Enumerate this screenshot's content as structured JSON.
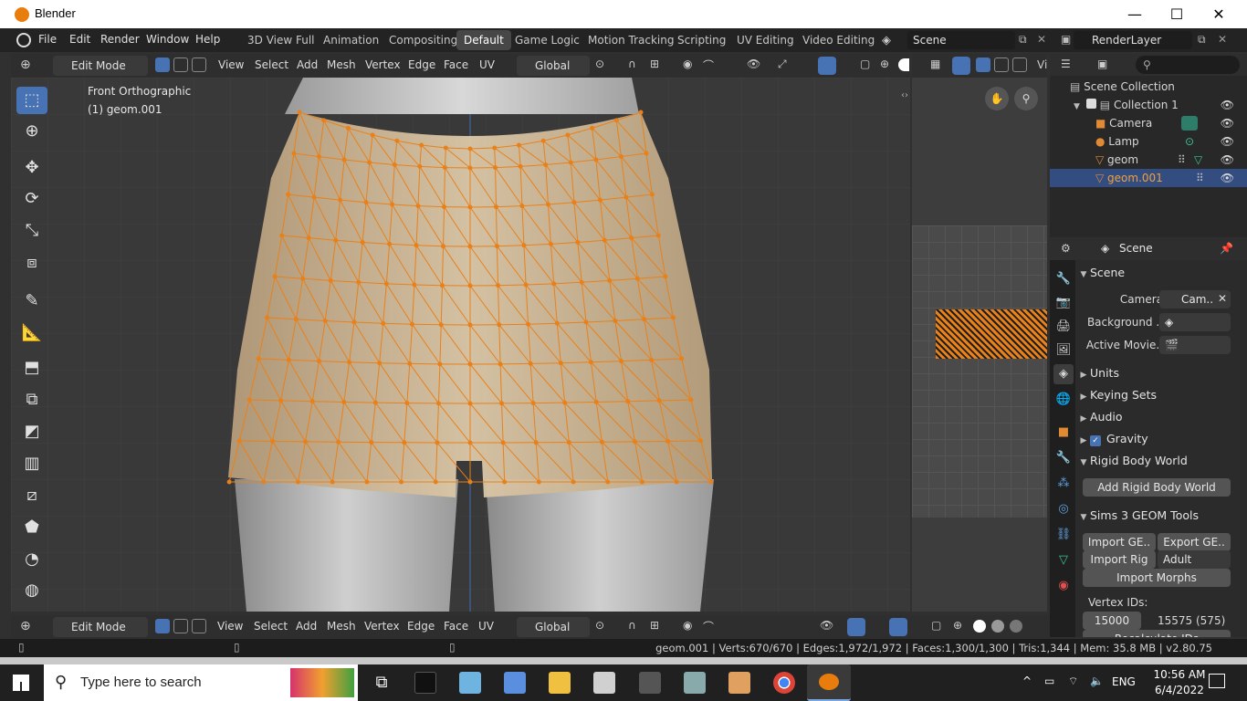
{
  "window": {
    "title": "Blender",
    "minimize": "—",
    "maximize": "☐",
    "close": "✕"
  },
  "menu": [
    "File",
    "Edit",
    "Render",
    "Window",
    "Help"
  ],
  "workspaces": [
    "3D View Full",
    "Animation",
    "Compositing",
    "Default",
    "Game Logic",
    "Motion Tracking",
    "Scripting",
    "UV Editing",
    "Video Editing"
  ],
  "active_workspace": "Default",
  "scene_field": "Scene",
  "renderlayer_field": "RenderLayer",
  "viewport_header": {
    "mode": "Edit Mode",
    "menus": [
      "View",
      "Select",
      "Add",
      "Mesh",
      "Vertex",
      "Edge",
      "Face",
      "UV"
    ],
    "orientation": "Global"
  },
  "viewport_info": {
    "view": "Front Orthographic",
    "object": "(1) geom.001"
  },
  "right_viewport": {
    "partial_label": "Vi"
  },
  "outliner": {
    "root": "Scene Collection",
    "collection": "Collection 1",
    "items": [
      {
        "label": "Camera"
      },
      {
        "label": "Lamp"
      },
      {
        "label": "geom"
      },
      {
        "label": "geom.001",
        "selected": true
      }
    ]
  },
  "properties": {
    "header": "Scene",
    "scene_section": "Scene",
    "camera_label": "Camera",
    "camera_value": "Cam..",
    "background_label": "Background ..",
    "active_movie_label": "Active Movie..",
    "sections": [
      "Units",
      "Keying Sets",
      "Audio",
      "Gravity",
      "Rigid Body World"
    ],
    "gravity_checked": true,
    "add_rigid_body": "Add Rigid Body World",
    "sims_section": "Sims 3 GEOM Tools",
    "import_geom": "Import GE..",
    "export_geom": "Export GE..",
    "import_rig": "Import Rig",
    "rig_type": "Adult",
    "import_morphs": "Import Morphs",
    "vertex_ids_label": "Vertex IDs:",
    "vertex_id_start": "15000",
    "vertex_id_end": "15575 (575)",
    "recalculate": "Recalculate IDs"
  },
  "status": {
    "text": "geom.001 | Verts:670/670 | Edges:1,972/1,972 | Faces:1,300/1,300 | Tris:1,344 | Mem: 35.8 MB | v2.80.75"
  },
  "taskbar": {
    "search_placeholder": "Type here to search",
    "lang": "ENG",
    "time": "10:56 AM",
    "date": "6/4/2022"
  },
  "colors": {
    "accent": "#4772b3",
    "mesh_orange": "#e8811a",
    "blender_orange": "#e87d0d",
    "outliner_selected": "#334d80"
  }
}
